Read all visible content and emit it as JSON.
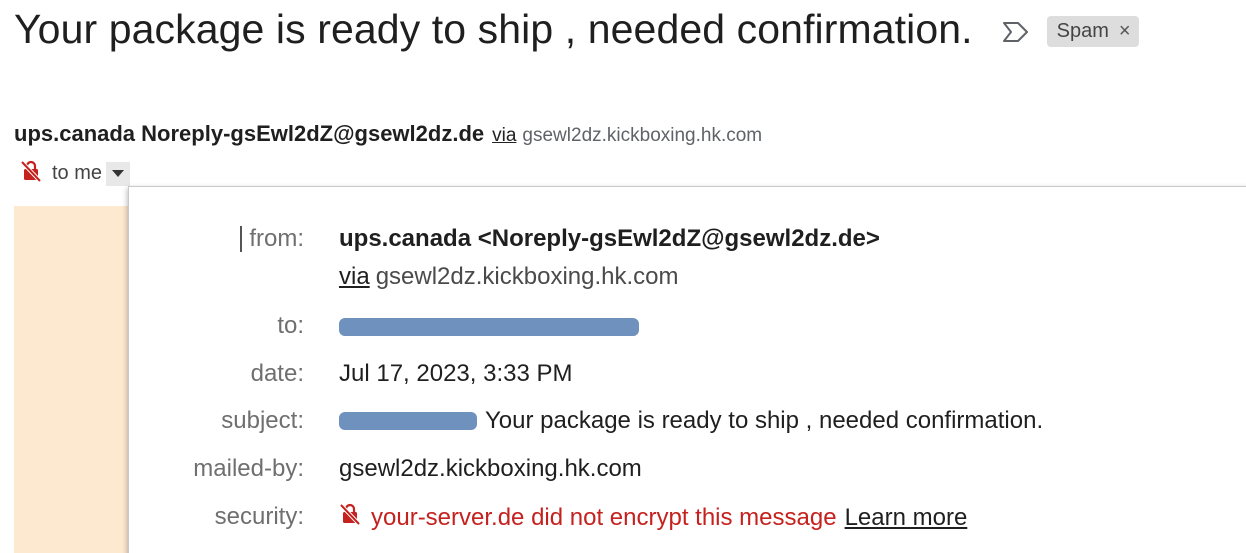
{
  "subject": {
    "title": "Your package is ready to ship , needed confirmation.",
    "important_icon": "important-marker-icon",
    "label_badge": "Spam",
    "label_remove": "×"
  },
  "sender": {
    "name_and_email": "ups.canada Noreply-gsEwl2dZ@gsewl2dz.de",
    "via_word": "via",
    "via_domain": "gsewl2dz.kickboxing.hk.com",
    "recipient_summary": "to me",
    "unencrypted_icon": "unencrypted-lock-icon",
    "details_dropdown_icon": "caret-down-icon"
  },
  "details": {
    "from_label": "from:",
    "from_value": "ups.canada <Noreply-gsEwl2dZ@gsewl2dz.de>",
    "from_via_word": "via",
    "from_via_domain": "gsewl2dz.kickboxing.hk.com",
    "to_label": "to:",
    "date_label": "date:",
    "date_value": "Jul 17, 2023, 3:33 PM",
    "subject_label": "subject:",
    "subject_value": "Your package is ready to ship , needed confirmation.",
    "mailedby_label": "mailed-by:",
    "mailedby_value": "gsewl2dz.kickboxing.hk.com",
    "security_label": "security:",
    "security_value": "your-server.de did not encrypt this message",
    "learn_more": "Learn more"
  },
  "colors": {
    "security_warning": "#c5221f",
    "redaction": "#6f91bd",
    "peach_background": "#fde8d0",
    "spam_badge_bg": "#dddddd"
  }
}
